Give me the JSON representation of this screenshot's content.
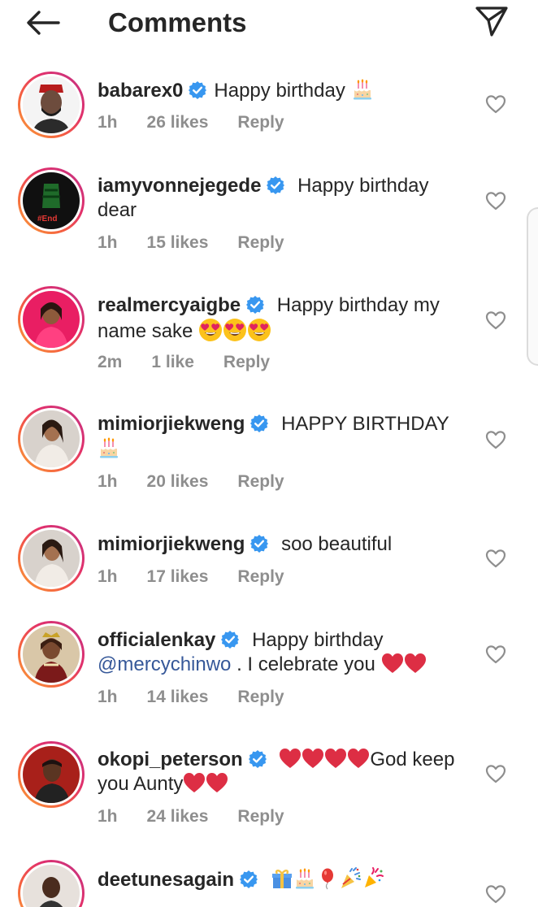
{
  "header": {
    "title": "Comments"
  },
  "comments": [
    {
      "username": "babarex0",
      "text": "Happy birthday",
      "time": "1h",
      "likes": "26 likes",
      "reply": "Reply"
    },
    {
      "username": "iamyvonnejegede",
      "text": "Happy birthday dear",
      "time": "1h",
      "likes": "15 likes",
      "reply": "Reply"
    },
    {
      "username": "realmercyaigbe",
      "text": "Happy birthday my name sake",
      "time": "2m",
      "likes": "1 like",
      "reply": "Reply"
    },
    {
      "username": "mimiorjiekweng",
      "text": "HAPPY BIRTHDAY",
      "time": "1h",
      "likes": "20 likes",
      "reply": "Reply"
    },
    {
      "username": "mimiorjiekweng",
      "text": "soo beautiful",
      "time": "1h",
      "likes": "17 likes",
      "reply": "Reply"
    },
    {
      "username": "officialenkay",
      "text": "Happy birthday",
      "mention": "@mercychinwo",
      "text2": ". I celebrate you",
      "time": "1h",
      "likes": "14 likes",
      "reply": "Reply"
    },
    {
      "username": "okopi_peterson",
      "text": "God keep you  Aunty",
      "time": "1h",
      "likes": "24 likes",
      "reply": "Reply"
    },
    {
      "username": "deetunesagain"
    }
  ],
  "colors": {
    "verified": "#3897f0",
    "heart_red": "#e0245e",
    "muted": "#8e8e8e",
    "mention": "#365899"
  },
  "icons": [
    "back-arrow-icon",
    "send-icon",
    "verified-badge-icon",
    "heart-outline-icon",
    "birthday-cake-emoji",
    "heart-eyes-emoji",
    "red-heart-emoji",
    "gift-emoji",
    "balloon-emoji",
    "party-popper-emoji"
  ]
}
